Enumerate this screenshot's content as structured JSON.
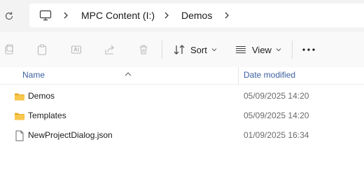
{
  "address_bar": {
    "breadcrumbs": [
      "MPC Content (I:)",
      "Demos"
    ]
  },
  "toolbar": {
    "sort_label": "Sort",
    "view_label": "View"
  },
  "columns": {
    "name": "Name",
    "date_modified": "Date modified"
  },
  "files": [
    {
      "name": "Demos",
      "date": "05/09/2025 14:20",
      "type": "folder"
    },
    {
      "name": "Templates",
      "date": "05/09/2025 14:20",
      "type": "folder"
    },
    {
      "name": "NewProjectDialog.json",
      "date": "01/09/2025 16:34",
      "type": "file"
    }
  ],
  "colors": {
    "folder": "#f8c74e",
    "header_text": "#3a5f9e",
    "disabled_icon": "#b9b9b9"
  },
  "icons": {
    "refresh": "refresh-icon",
    "computer": "computer-icon",
    "copy": "copy-icon",
    "paste": "paste-icon",
    "rename": "rename-icon",
    "share": "share-icon",
    "delete": "delete-icon",
    "sort": "sort-icon",
    "view": "view-icon",
    "more": "more-icon"
  }
}
